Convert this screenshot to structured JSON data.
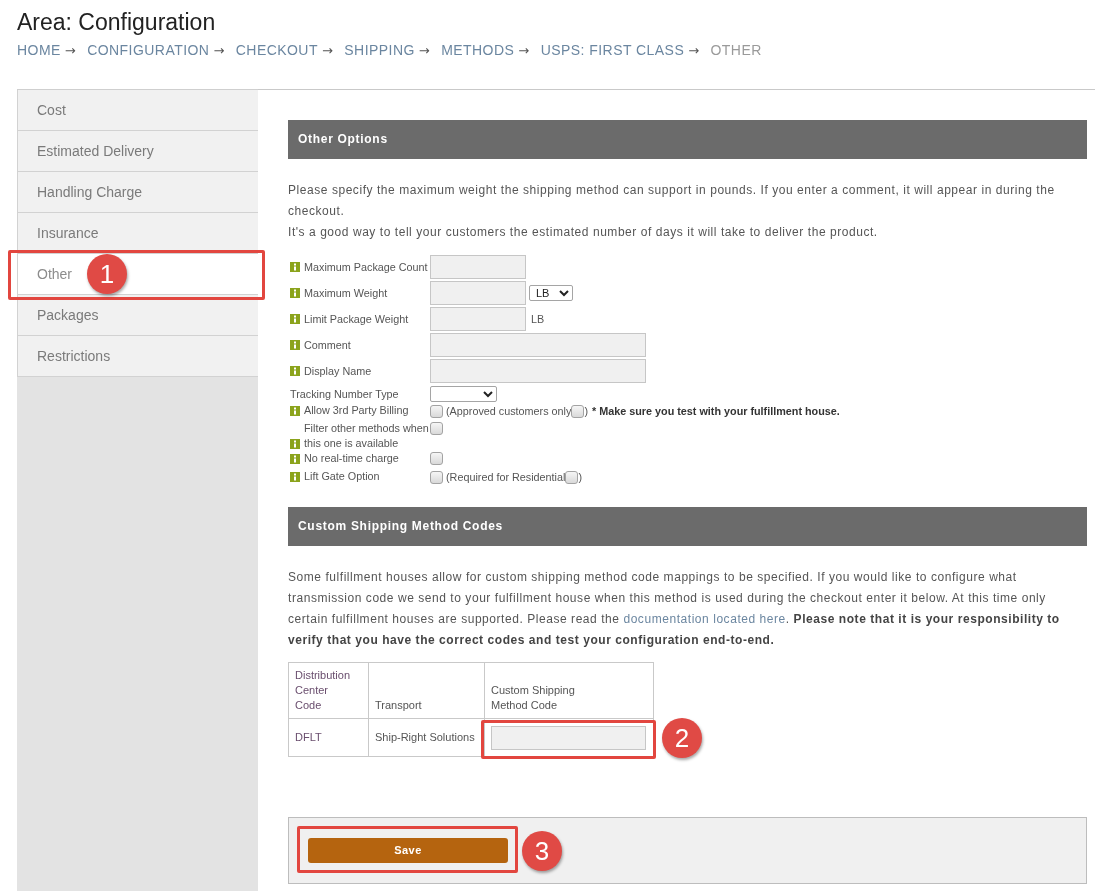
{
  "page": {
    "title": "Area: Configuration"
  },
  "breadcrumb": [
    {
      "label": "HOME",
      "separator": "→",
      "current": false
    },
    {
      "label": "CONFIGURATION",
      "separator": "→",
      "current": false
    },
    {
      "label": "CHECKOUT",
      "separator": "→",
      "current": false
    },
    {
      "label": "SHIPPING",
      "separator": "→",
      "current": false
    },
    {
      "label": "METHODS",
      "separator": "→",
      "current": false
    },
    {
      "label": "USPS: FIRST CLASS",
      "separator": "→",
      "current": false
    },
    {
      "label": "OTHER",
      "current": true
    }
  ],
  "sidebar": {
    "items": [
      {
        "label": "Cost",
        "selected": false
      },
      {
        "label": "Estimated Delivery",
        "selected": false
      },
      {
        "label": "Handling Charge",
        "selected": false
      },
      {
        "label": "Insurance",
        "selected": false
      },
      {
        "label": "Other",
        "selected": true,
        "callout": "1"
      },
      {
        "label": "Packages",
        "selected": false
      },
      {
        "label": "Restrictions",
        "selected": false
      }
    ]
  },
  "other_options": {
    "title": "Other Options",
    "description": [
      "Please specify the maximum weight the shipping method can support in pounds. If you enter a comment, it will appear in during the checkout.",
      "It's a good way to tell your customers the estimated number of days it will take to deliver the product."
    ],
    "fields": [
      {
        "kind": "number",
        "label": "Maximum Package Count",
        "help": true
      },
      {
        "kind": "number",
        "label": "Maximum Weight",
        "help": true,
        "unit_select": "LB"
      },
      {
        "kind": "number",
        "label": "Limit Package Weight",
        "help": true,
        "unit": "LB"
      },
      {
        "kind": "text",
        "label": "Comment",
        "help": true
      },
      {
        "kind": "text",
        "label": "Display Name",
        "help": true
      },
      {
        "kind": "select",
        "label": "Tracking Number Type",
        "help": false
      },
      {
        "kind": "checkbox",
        "label": "Allow 3rd Party Billing",
        "help": true,
        "checked": false,
        "option": {
          "label": "(Approved customers only",
          "checked": false,
          "close": ")"
        },
        "note": "* Make sure you test with your fulfillment house."
      },
      {
        "kind": "checkbox",
        "label": "Filter other methods when this one is available",
        "help": true,
        "checked": false
      },
      {
        "kind": "checkbox",
        "label": "No real-time charge",
        "help": true,
        "checked": false
      },
      {
        "kind": "checkbox",
        "label": "Lift Gate Option",
        "help": true,
        "checked": false,
        "option": {
          "label": "(Required for Residential",
          "checked": false,
          "close": ")"
        }
      }
    ]
  },
  "custom_codes": {
    "title": "Custom Shipping Method Codes",
    "intro": {
      "before": "Some fulfillment houses allow for custom shipping method code mappings to be specified. If you would like to configure what transmission code we send to your fulfillment house when this method is used during the checkout enter it below. At this time only certain fulfillment houses are supported. Please read the ",
      "link": "documentation located here",
      "after": ". **Please note that it is your responsibility to verify that you have the correct codes and test your configuration end-to-end.**"
    },
    "table": {
      "columns": [
        "Distribution Center Code",
        "Transport",
        "Custom Shipping Method Code"
      ],
      "rows": [
        {
          "center_code": "DFLT",
          "transport": "Ship-Right Solutions",
          "callout": "2"
        }
      ]
    }
  },
  "save_button": {
    "label": "Save",
    "callout": "3"
  }
}
